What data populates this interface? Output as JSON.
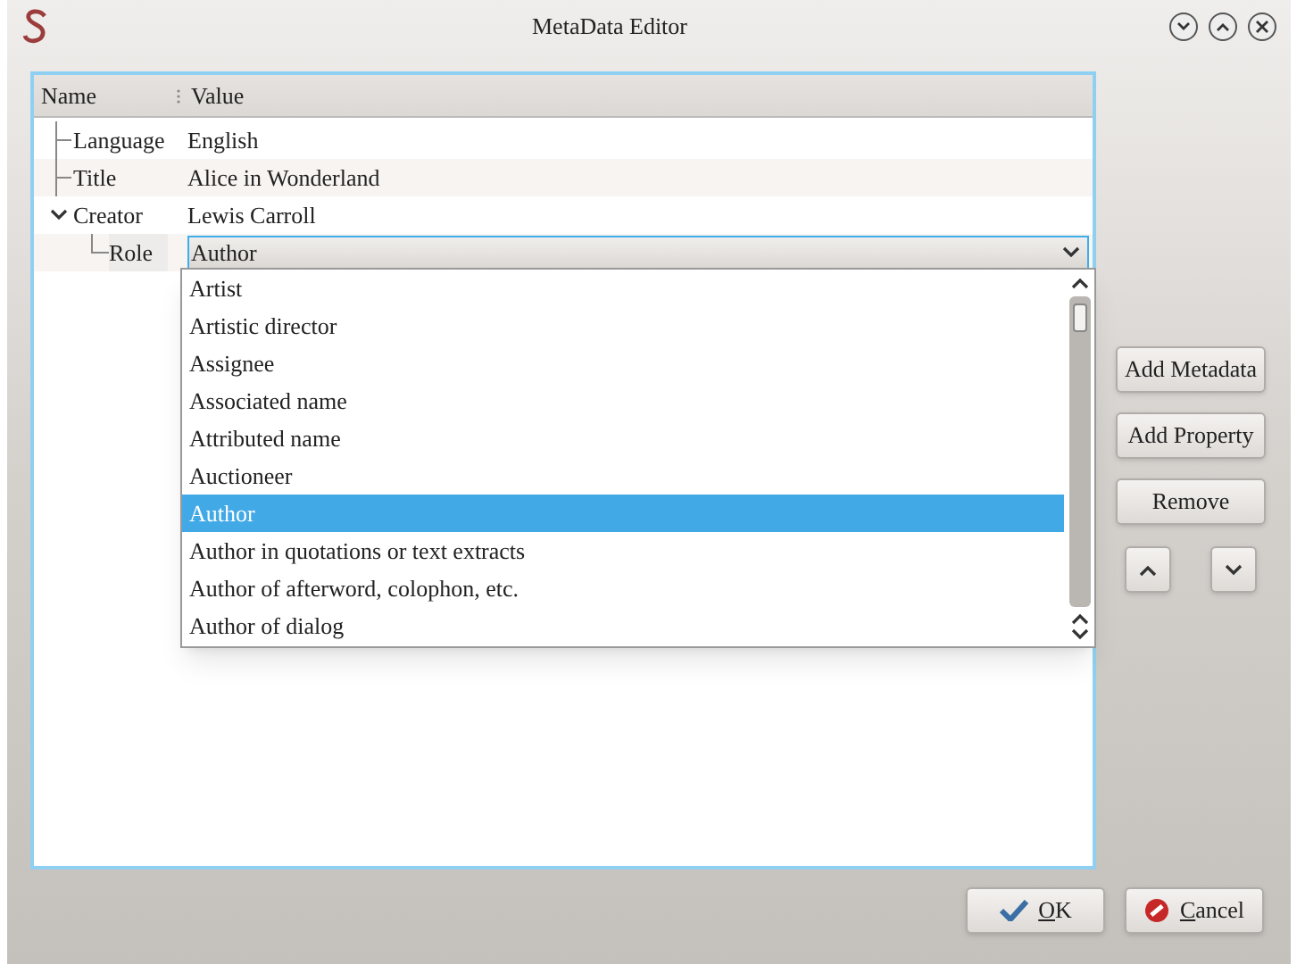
{
  "window": {
    "title": "MetaData Editor"
  },
  "tree": {
    "columns": [
      "Name",
      "Value"
    ],
    "items": [
      {
        "name": "Language",
        "value": "English"
      },
      {
        "name": "Title",
        "value": "Alice in Wonderland"
      },
      {
        "name": "Creator",
        "value": "Lewis Carroll",
        "expanded": true,
        "children": [
          {
            "name": "Role",
            "value": "Author",
            "kind": "combo"
          }
        ]
      }
    ]
  },
  "dropdown": {
    "options": [
      {
        "label": "Artist",
        "selected": false
      },
      {
        "label": "Artistic director",
        "selected": false
      },
      {
        "label": "Assignee",
        "selected": false
      },
      {
        "label": "Associated name",
        "selected": false
      },
      {
        "label": "Attributed name",
        "selected": false
      },
      {
        "label": "Auctioneer",
        "selected": false
      },
      {
        "label": "Author",
        "selected": true
      },
      {
        "label": "Author in quotations or text extracts",
        "selected": false
      },
      {
        "label": "Author of afterword, colophon, etc.",
        "selected": false
      },
      {
        "label": "Author of dialog",
        "selected": false
      }
    ]
  },
  "side_buttons": [
    "Add Metadata",
    "Add Property",
    "Remove"
  ],
  "ok_button": "OK",
  "cancel_button": "Cancel"
}
